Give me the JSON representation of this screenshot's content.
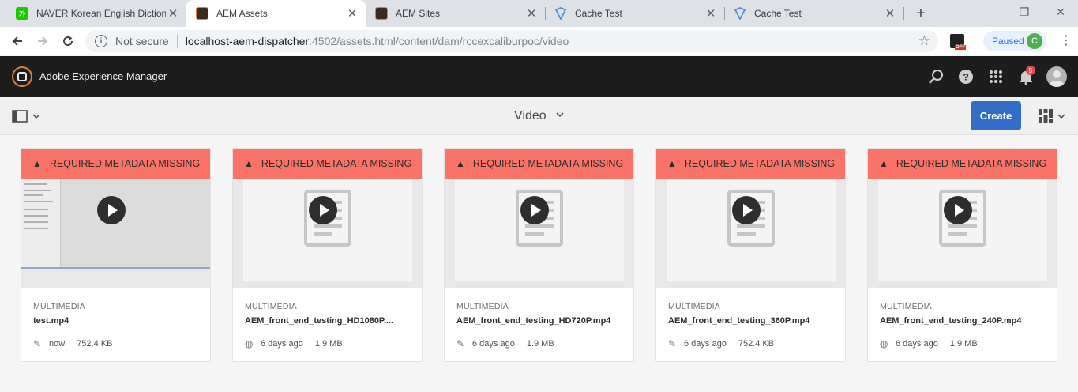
{
  "browser": {
    "tabs": [
      {
        "title": "NAVER Korean English Dictiona",
        "favicon": "naver-dictionary-icon",
        "favicon_color": "#1ec800",
        "favicon_text": "가",
        "active": false
      },
      {
        "title": "AEM Assets",
        "favicon": "aem-icon",
        "favicon_color": "#3a2a20",
        "active": true
      },
      {
        "title": "AEM Sites",
        "favicon": "aem-icon",
        "favicon_color": "#3a2a20",
        "active": false
      },
      {
        "title": "Cache Test",
        "favicon": "shield-icon",
        "favicon_color": "#4a90d9",
        "active": false
      },
      {
        "title": "Cache Test",
        "favicon": "shield-icon",
        "favicon_color": "#4a90d9",
        "active": false
      }
    ],
    "security_label": "Not secure",
    "url_host": "localhost-aem-dispatcher",
    "url_rest": ":4502/assets.html/content/dam/rccexcaliburpoc/video",
    "extension_badge": "OFF",
    "profile_status": "Paused",
    "profile_initial": "C"
  },
  "aem": {
    "product_name": "Adobe Experience Manager",
    "notification_count": "5",
    "page_title": "Video",
    "create_label": "Create",
    "brand_color": "#326ec8",
    "alert_color": "#fa7369"
  },
  "cards": [
    {
      "alert": "REQUIRED METADATA MISSING",
      "type": "MULTIMEDIA",
      "name": "test.mp4",
      "meta_icon": "pencil-icon",
      "time": "now",
      "size": "752.4 KB",
      "thumb": "screenshot"
    },
    {
      "alert": "REQUIRED METADATA MISSING",
      "type": "MULTIMEDIA",
      "name": "AEM_front_end_testing_HD1080P....",
      "meta_icon": "globe-icon",
      "time": "6 days ago",
      "size": "1.9 MB",
      "thumb": "document"
    },
    {
      "alert": "REQUIRED METADATA MISSING",
      "type": "MULTIMEDIA",
      "name": "AEM_front_end_testing_HD720P.mp4",
      "meta_icon": "pencil-icon",
      "time": "6 days ago",
      "size": "1.9 MB",
      "thumb": "document"
    },
    {
      "alert": "REQUIRED METADATA MISSING",
      "type": "MULTIMEDIA",
      "name": "AEM_front_end_testing_360P.mp4",
      "meta_icon": "pencil-icon",
      "time": "6 days ago",
      "size": "752.4 KB",
      "thumb": "document"
    },
    {
      "alert": "REQUIRED METADATA MISSING",
      "type": "MULTIMEDIA",
      "name": "AEM_front_end_testing_240P.mp4",
      "meta_icon": "globe-icon",
      "time": "6 days ago",
      "size": "1.9 MB",
      "thumb": "document"
    }
  ]
}
